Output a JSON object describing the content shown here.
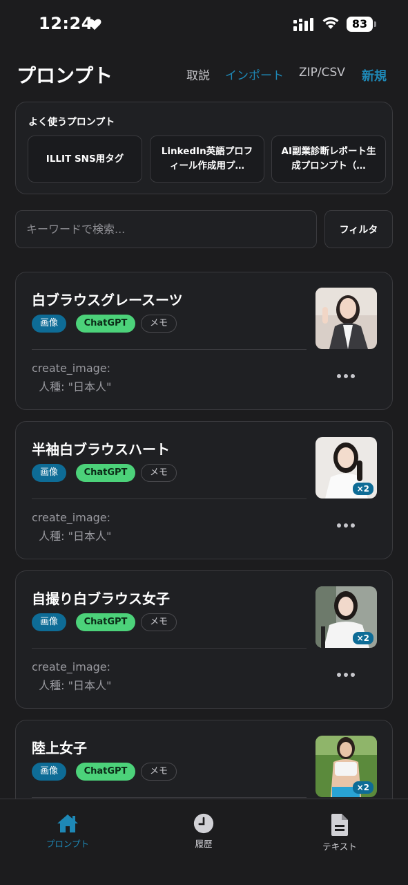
{
  "status_bar": {
    "time": "12:24",
    "battery": "83"
  },
  "header": {
    "title": "プロンプト",
    "howto": "取説",
    "import": "インポート",
    "zip_csv": "ZIP/CSV",
    "new": "新規"
  },
  "favorites": {
    "title": "よく使うプロンプト",
    "items": [
      "ILLIT SNS用タグ",
      "LinkedIn英語プロフィール作成用プ…",
      "AI副業診断レポート生成プロンプト（…"
    ]
  },
  "search": {
    "placeholder": "キーワードで検索...",
    "filter_label": "フィルタ"
  },
  "cards": [
    {
      "title": "白ブラウスグレースーツ",
      "tags": [
        "画像",
        "ChatGPT",
        "メモ"
      ],
      "body": "create_image:\n  人種: \"日本人\"",
      "image_count": ""
    },
    {
      "title": "半袖白ブラウスハート",
      "tags": [
        "画像",
        "ChatGPT",
        "メモ"
      ],
      "body": "create_image:\n  人種: \"日本人\"",
      "image_count": "×2"
    },
    {
      "title": "自撮り白ブラウス女子",
      "tags": [
        "画像",
        "ChatGPT",
        "メモ"
      ],
      "body": "create_image:\n  人種: \"日本人\"",
      "image_count": "×2"
    },
    {
      "title": "陸上女子",
      "tags": [
        "画像",
        "ChatGPT",
        "メモ"
      ],
      "body": "",
      "image_count": "×2"
    }
  ],
  "tab_bar": {
    "prompt": "プロンプト",
    "history": "履歴",
    "text": "テキスト"
  },
  "colors": {
    "accent": "#1e88b6",
    "chatgpt_tag": "#4cd27a",
    "image_tag": "#0e6c96",
    "background": "#1c1c1e"
  },
  "icons": [
    "heart-icon",
    "signal-icon",
    "wifi-icon",
    "battery-icon",
    "more-icon",
    "home-icon",
    "clock-icon",
    "document-icon"
  ]
}
